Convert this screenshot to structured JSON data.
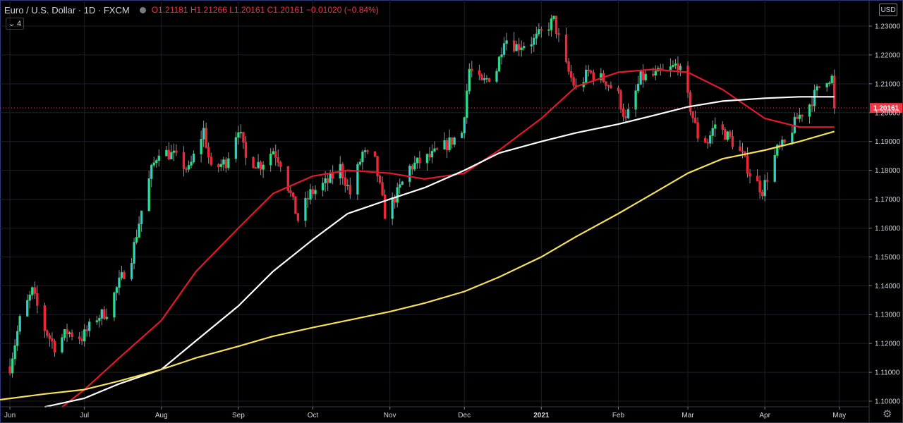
{
  "header": {
    "symbol": "Euro / U.S. Dollar · 1D · FXCM",
    "ohlc": "O1.21181 H1.21266 L1.20161 C1.20161 −0.01020 (−0.84%)",
    "indicator_count": "4"
  },
  "currency_button": "USD",
  "colors": {
    "background": "#000000",
    "up": "#26d64a",
    "up_fill": "#31cfe3",
    "down": "#ef2637",
    "ma_red": "#e3182a",
    "ma_white": "#ffffff",
    "ma_yellow": "#f6e05a",
    "last_price_label": "#f23645"
  },
  "chart_data": {
    "type": "candlestick",
    "title": "Euro / U.S. Dollar",
    "interval": "1D",
    "source": "FXCM",
    "last_price": 1.20161,
    "last_price_label": "1.20161",
    "y_ticks": [
      "1.23000",
      "1.22000",
      "1.21000",
      "1.20000",
      "1.19000",
      "1.18000",
      "1.17000",
      "1.16000",
      "1.15000",
      "1.14000",
      "1.13000",
      "1.12000",
      "1.11000",
      "1.10000"
    ],
    "ylim": [
      1.098,
      1.235
    ],
    "x_labels": [
      "Jun",
      "Jul",
      "Aug",
      "Sep",
      "Oct",
      "Nov",
      "Dec",
      "2021",
      "Feb",
      "Mar",
      "Apr",
      "May"
    ],
    "grid": true,
    "close_series_anchors": [
      {
        "date": "2020-06-01",
        "close": 1.112
      },
      {
        "date": "2020-06-05",
        "close": 1.128
      },
      {
        "date": "2020-06-10",
        "close": 1.138
      },
      {
        "date": "2020-06-15",
        "close": 1.125
      },
      {
        "date": "2020-06-19",
        "close": 1.119
      },
      {
        "date": "2020-06-24",
        "close": 1.124
      },
      {
        "date": "2020-06-30",
        "close": 1.122
      },
      {
        "date": "2020-07-06",
        "close": 1.129
      },
      {
        "date": "2020-07-10",
        "close": 1.131
      },
      {
        "date": "2020-07-15",
        "close": 1.141
      },
      {
        "date": "2020-07-20",
        "close": 1.15
      },
      {
        "date": "2020-07-24",
        "close": 1.166
      },
      {
        "date": "2020-07-28",
        "close": 1.18
      },
      {
        "date": "2020-07-31",
        "close": 1.187
      },
      {
        "date": "2020-08-06",
        "close": 1.185
      },
      {
        "date": "2020-08-12",
        "close": 1.18
      },
      {
        "date": "2020-08-18",
        "close": 1.194
      },
      {
        "date": "2020-08-21",
        "close": 1.18
      },
      {
        "date": "2020-08-27",
        "close": 1.183
      },
      {
        "date": "2020-09-01",
        "close": 1.195
      },
      {
        "date": "2020-09-04",
        "close": 1.184
      },
      {
        "date": "2020-09-10",
        "close": 1.182
      },
      {
        "date": "2020-09-15",
        "close": 1.187
      },
      {
        "date": "2020-09-18",
        "close": 1.183
      },
      {
        "date": "2020-09-25",
        "close": 1.163
      },
      {
        "date": "2020-09-30",
        "close": 1.172
      },
      {
        "date": "2020-10-07",
        "close": 1.176
      },
      {
        "date": "2020-10-12",
        "close": 1.181
      },
      {
        "date": "2020-10-16",
        "close": 1.172
      },
      {
        "date": "2020-10-21",
        "close": 1.186
      },
      {
        "date": "2020-10-26",
        "close": 1.183
      },
      {
        "date": "2020-10-30",
        "close": 1.165
      },
      {
        "date": "2020-11-04",
        "close": 1.172
      },
      {
        "date": "2020-11-09",
        "close": 1.181
      },
      {
        "date": "2020-11-13",
        "close": 1.183
      },
      {
        "date": "2020-11-18",
        "close": 1.185
      },
      {
        "date": "2020-11-24",
        "close": 1.189
      },
      {
        "date": "2020-11-30",
        "close": 1.193
      },
      {
        "date": "2020-12-03",
        "close": 1.215
      },
      {
        "date": "2020-12-08",
        "close": 1.21
      },
      {
        "date": "2020-12-14",
        "close": 1.215
      },
      {
        "date": "2020-12-17",
        "close": 1.226
      },
      {
        "date": "2020-12-22",
        "close": 1.223
      },
      {
        "date": "2020-12-29",
        "close": 1.225
      },
      {
        "date": "2021-01-06",
        "close": 1.232
      },
      {
        "date": "2021-01-11",
        "close": 1.216
      },
      {
        "date": "2021-01-15",
        "close": 1.208
      },
      {
        "date": "2021-01-20",
        "close": 1.214
      },
      {
        "date": "2021-01-27",
        "close": 1.211
      },
      {
        "date": "2021-02-01",
        "close": 1.206
      },
      {
        "date": "2021-02-04",
        "close": 1.197
      },
      {
        "date": "2021-02-10",
        "close": 1.212
      },
      {
        "date": "2021-02-16",
        "close": 1.213
      },
      {
        "date": "2021-02-22",
        "close": 1.215
      },
      {
        "date": "2021-02-25",
        "close": 1.217
      },
      {
        "date": "2021-03-01",
        "close": 1.205
      },
      {
        "date": "2021-03-05",
        "close": 1.192
      },
      {
        "date": "2021-03-09",
        "close": 1.19
      },
      {
        "date": "2021-03-12",
        "close": 1.196
      },
      {
        "date": "2021-03-18",
        "close": 1.191
      },
      {
        "date": "2021-03-23",
        "close": 1.185
      },
      {
        "date": "2021-03-26",
        "close": 1.179
      },
      {
        "date": "2021-03-31",
        "close": 1.173
      },
      {
        "date": "2021-04-06",
        "close": 1.187
      },
      {
        "date": "2021-04-09",
        "close": 1.189
      },
      {
        "date": "2021-04-14",
        "close": 1.198
      },
      {
        "date": "2021-04-19",
        "close": 1.203
      },
      {
        "date": "2021-04-23",
        "close": 1.209
      },
      {
        "date": "2021-04-26",
        "close": 1.212
      },
      {
        "date": "2021-04-28",
        "close": 1.212
      },
      {
        "date": "2021-04-29",
        "close": 1.2016
      }
    ],
    "series": [
      {
        "color": "#e3182a",
        "points": [
          {
            "date": "2020-06-22",
            "value": 1.098
          },
          {
            "date": "2020-07-01",
            "value": 1.104
          },
          {
            "date": "2020-07-15",
            "value": 1.115
          },
          {
            "date": "2020-08-01",
            "value": 1.128
          },
          {
            "date": "2020-08-15",
            "value": 1.145
          },
          {
            "date": "2020-09-01",
            "value": 1.16
          },
          {
            "date": "2020-09-15",
            "value": 1.172
          },
          {
            "date": "2020-10-01",
            "value": 1.178
          },
          {
            "date": "2020-10-15",
            "value": 1.18
          },
          {
            "date": "2020-11-01",
            "value": 1.179
          },
          {
            "date": "2020-11-15",
            "value": 1.177
          },
          {
            "date": "2020-12-01",
            "value": 1.179
          },
          {
            "date": "2020-12-15",
            "value": 1.187
          },
          {
            "date": "2021-01-01",
            "value": 1.198
          },
          {
            "date": "2021-01-15",
            "value": 1.209
          },
          {
            "date": "2021-02-01",
            "value": 1.214
          },
          {
            "date": "2021-02-15",
            "value": 1.215
          },
          {
            "date": "2021-03-01",
            "value": 1.214
          },
          {
            "date": "2021-03-15",
            "value": 1.208
          },
          {
            "date": "2021-04-01",
            "value": 1.198
          },
          {
            "date": "2021-04-15",
            "value": 1.195
          },
          {
            "date": "2021-04-29",
            "value": 1.195
          }
        ]
      },
      {
        "color": "#ffffff",
        "points": [
          {
            "date": "2020-06-15",
            "value": 1.098
          },
          {
            "date": "2020-07-01",
            "value": 1.101
          },
          {
            "date": "2020-07-15",
            "value": 1.106
          },
          {
            "date": "2020-08-01",
            "value": 1.111
          },
          {
            "date": "2020-08-15",
            "value": 1.121
          },
          {
            "date": "2020-09-01",
            "value": 1.133
          },
          {
            "date": "2020-09-15",
            "value": 1.145
          },
          {
            "date": "2020-10-01",
            "value": 1.156
          },
          {
            "date": "2020-10-15",
            "value": 1.165
          },
          {
            "date": "2020-11-01",
            "value": 1.17
          },
          {
            "date": "2020-11-15",
            "value": 1.174
          },
          {
            "date": "2020-12-01",
            "value": 1.18
          },
          {
            "date": "2020-12-15",
            "value": 1.186
          },
          {
            "date": "2021-01-01",
            "value": 1.19
          },
          {
            "date": "2021-01-15",
            "value": 1.193
          },
          {
            "date": "2021-02-01",
            "value": 1.196
          },
          {
            "date": "2021-02-15",
            "value": 1.199
          },
          {
            "date": "2021-03-01",
            "value": 1.202
          },
          {
            "date": "2021-03-15",
            "value": 1.204
          },
          {
            "date": "2021-04-01",
            "value": 1.205
          },
          {
            "date": "2021-04-15",
            "value": 1.2055
          },
          {
            "date": "2021-04-29",
            "value": 1.2055
          }
        ]
      },
      {
        "color": "#f6e05a",
        "points": [
          {
            "date": "2020-05-28",
            "value": 1.1005
          },
          {
            "date": "2020-06-15",
            "value": 1.1025
          },
          {
            "date": "2020-07-01",
            "value": 1.104
          },
          {
            "date": "2020-07-15",
            "value": 1.107
          },
          {
            "date": "2020-08-01",
            "value": 1.111
          },
          {
            "date": "2020-08-15",
            "value": 1.115
          },
          {
            "date": "2020-09-01",
            "value": 1.119
          },
          {
            "date": "2020-09-15",
            "value": 1.1225
          },
          {
            "date": "2020-10-01",
            "value": 1.1255
          },
          {
            "date": "2020-10-15",
            "value": 1.128
          },
          {
            "date": "2020-11-01",
            "value": 1.131
          },
          {
            "date": "2020-11-15",
            "value": 1.134
          },
          {
            "date": "2020-12-01",
            "value": 1.138
          },
          {
            "date": "2020-12-15",
            "value": 1.143
          },
          {
            "date": "2021-01-01",
            "value": 1.15
          },
          {
            "date": "2021-01-15",
            "value": 1.157
          },
          {
            "date": "2021-02-01",
            "value": 1.165
          },
          {
            "date": "2021-02-15",
            "value": 1.172
          },
          {
            "date": "2021-03-01",
            "value": 1.179
          },
          {
            "date": "2021-03-15",
            "value": 1.184
          },
          {
            "date": "2021-04-01",
            "value": 1.187
          },
          {
            "date": "2021-04-15",
            "value": 1.19
          },
          {
            "date": "2021-04-29",
            "value": 1.1935
          }
        ]
      }
    ]
  }
}
